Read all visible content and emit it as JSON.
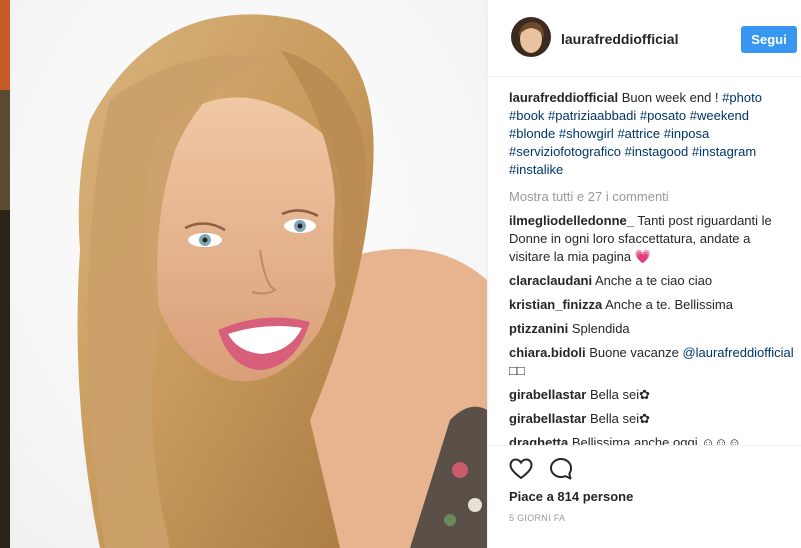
{
  "post": {
    "author": "laurafreddiofficial",
    "follow_label": "Segui",
    "caption_text": " Buon week end ! ",
    "hashtags": [
      "#photo",
      "#book",
      "#patriziaabbadi",
      "#posato",
      "#weekend",
      "#blonde",
      "#showgirl",
      "#attrice",
      "#inposa",
      "#serviziofotografico",
      "#instagood",
      "#instagram",
      "#instalike"
    ],
    "show_all_comments": "Mostra tutti e 27 i commenti",
    "comments": [
      {
        "user": "ilmegliodelledonne_",
        "text": " Tanti post riguardanti le Donne in ogni loro sfaccettatura, andate a visitare la mia pagina 💗"
      },
      {
        "user": "claraclaudani",
        "text": " Anche a te ciao ciao"
      },
      {
        "user": "kristian_finizza",
        "text": " Anche a te. Bellissima"
      },
      {
        "user": "ptizzanini",
        "text": " Splendida"
      },
      {
        "user": "chiara.bidoli",
        "text": " Buone vacanze ",
        "mention": "@laurafreddiofficial",
        "suffix": " □□"
      },
      {
        "user": "girabellastar",
        "text": " Bella sei✿"
      },
      {
        "user": "girabellastar",
        "text": " Bella sei✿"
      },
      {
        "user": "draghetta",
        "text": " Bellissima anche oggi ☺☺☺"
      }
    ],
    "likes_label": "Piace a 814 persone",
    "date_label": "5 GIORNI FA"
  },
  "icons": {
    "like": "heart-outline-icon",
    "comment": "comment-bubble-icon"
  },
  "colors": {
    "accent": "#3897f0",
    "hashtag": "#003569",
    "muted": "#999999",
    "divider": "#efefef"
  }
}
